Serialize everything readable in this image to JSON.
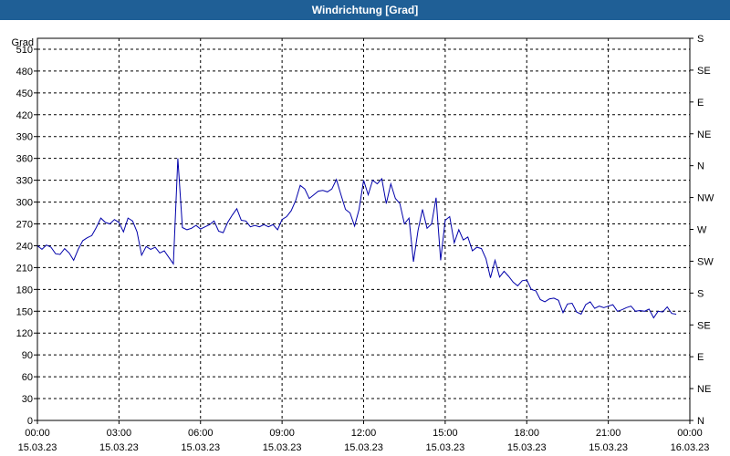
{
  "header": {
    "title": "Windrichtung [Grad]"
  },
  "chart_data": {
    "type": "line",
    "title": "Windrichtung [Grad]",
    "ylabel": "Grad",
    "xlabel": "",
    "ylim": [
      0,
      525
    ],
    "y_ticks": [
      0,
      30,
      60,
      90,
      120,
      150,
      180,
      210,
      240,
      270,
      300,
      330,
      360,
      390,
      420,
      450,
      480,
      510
    ],
    "y2_ticks": [
      {
        "value": 0,
        "label": "N"
      },
      {
        "value": 45,
        "label": "NE"
      },
      {
        "value": 90,
        "label": "E"
      },
      {
        "value": 135,
        "label": "SE"
      },
      {
        "value": 180,
        "label": "S"
      },
      {
        "value": 225,
        "label": "SW"
      },
      {
        "value": 270,
        "label": "W"
      },
      {
        "value": 315,
        "label": "NW"
      },
      {
        "value": 360,
        "label": "N"
      },
      {
        "value": 405,
        "label": "NE"
      },
      {
        "value": 450,
        "label": "E"
      },
      {
        "value": 495,
        "label": "SE"
      },
      {
        "value": 540,
        "label": "S"
      }
    ],
    "x_range": [
      "15.03.23 00:00",
      "16.03.23 00:00"
    ],
    "x_ticks": [
      {
        "time": "00:00",
        "date": "15.03.23"
      },
      {
        "time": "03:00",
        "date": "15.03.23"
      },
      {
        "time": "06:00",
        "date": "15.03.23"
      },
      {
        "time": "09:00",
        "date": "15.03.23"
      },
      {
        "time": "12:00",
        "date": "15.03.23"
      },
      {
        "time": "15:00",
        "date": "15.03.23"
      },
      {
        "time": "18:00",
        "date": "15.03.23"
      },
      {
        "time": "21:00",
        "date": "15.03.23"
      },
      {
        "time": "00:00",
        "date": "16.03.23"
      }
    ],
    "grid": true,
    "series": [
      {
        "color": "#0000aa",
        "points": [
          [
            "00:00",
            240
          ],
          [
            "00:10",
            235
          ],
          [
            "00:20",
            241
          ],
          [
            "00:30",
            238
          ],
          [
            "00:40",
            229
          ],
          [
            "00:50",
            228
          ],
          [
            "01:00",
            236
          ],
          [
            "01:10",
            230
          ],
          [
            "01:20",
            220
          ],
          [
            "01:30",
            235
          ],
          [
            "01:40",
            247
          ],
          [
            "01:50",
            251
          ],
          [
            "02:00",
            254
          ],
          [
            "02:10",
            265
          ],
          [
            "02:20",
            278
          ],
          [
            "02:30",
            272
          ],
          [
            "02:40",
            270
          ],
          [
            "02:50",
            276
          ],
          [
            "03:00",
            272
          ],
          [
            "03:10",
            259
          ],
          [
            "03:20",
            278
          ],
          [
            "03:30",
            274
          ],
          [
            "03:40",
            259
          ],
          [
            "03:50",
            227
          ],
          [
            "04:00",
            239
          ],
          [
            "04:10",
            235
          ],
          [
            "04:20",
            238
          ],
          [
            "04:30",
            230
          ],
          [
            "04:40",
            233
          ],
          [
            "04:50",
            224
          ],
          [
            "05:00",
            215
          ],
          [
            "05:10",
            360
          ],
          [
            "05:20",
            265
          ],
          [
            "05:30",
            262
          ],
          [
            "05:40",
            264
          ],
          [
            "05:50",
            268
          ],
          [
            "06:00",
            263
          ],
          [
            "06:10",
            266
          ],
          [
            "06:20",
            269
          ],
          [
            "06:30",
            274
          ],
          [
            "06:40",
            260
          ],
          [
            "06:50",
            258
          ],
          [
            "07:00",
            272
          ],
          [
            "07:10",
            282
          ],
          [
            "07:20",
            291
          ],
          [
            "07:30",
            275
          ],
          [
            "07:40",
            274
          ],
          [
            "07:50",
            266
          ],
          [
            "08:00",
            268
          ],
          [
            "08:10",
            266
          ],
          [
            "08:20",
            269
          ],
          [
            "08:30",
            266
          ],
          [
            "08:40",
            269
          ],
          [
            "08:50",
            262
          ],
          [
            "09:00",
            276
          ],
          [
            "09:10",
            280
          ],
          [
            "09:20",
            288
          ],
          [
            "09:30",
            302
          ],
          [
            "09:40",
            323
          ],
          [
            "09:50",
            318
          ],
          [
            "10:00",
            305
          ],
          [
            "10:10",
            310
          ],
          [
            "10:20",
            315
          ],
          [
            "10:30",
            316
          ],
          [
            "10:40",
            314
          ],
          [
            "10:50",
            318
          ],
          [
            "11:00",
            331
          ],
          [
            "11:10",
            310
          ],
          [
            "11:20",
            290
          ],
          [
            "11:30",
            285
          ],
          [
            "11:40",
            267
          ],
          [
            "11:50",
            290
          ],
          [
            "12:00",
            330
          ],
          [
            "12:10",
            310
          ],
          [
            "12:20",
            330
          ],
          [
            "12:30",
            325
          ],
          [
            "12:40",
            332
          ],
          [
            "12:50",
            298
          ],
          [
            "13:00",
            325
          ],
          [
            "13:10",
            305
          ],
          [
            "13:20",
            298
          ],
          [
            "13:30",
            270
          ],
          [
            "13:40",
            278
          ],
          [
            "13:50",
            218
          ],
          [
            "14:00",
            261
          ],
          [
            "14:10",
            290
          ],
          [
            "14:20",
            264
          ],
          [
            "14:30",
            270
          ],
          [
            "14:40",
            306
          ],
          [
            "14:50",
            220
          ],
          [
            "15:00",
            275
          ],
          [
            "15:10",
            280
          ],
          [
            "15:20",
            244
          ],
          [
            "15:30",
            262
          ],
          [
            "15:40",
            248
          ],
          [
            "15:50",
            252
          ],
          [
            "16:00",
            233
          ],
          [
            "16:10",
            238
          ],
          [
            "16:20",
            236
          ],
          [
            "16:30",
            222
          ],
          [
            "16:40",
            196
          ],
          [
            "16:50",
            220
          ],
          [
            "17:00",
            197
          ],
          [
            "17:10",
            205
          ],
          [
            "17:20",
            198
          ],
          [
            "17:30",
            190
          ],
          [
            "17:40",
            185
          ],
          [
            "17:50",
            192
          ],
          [
            "18:00",
            193
          ],
          [
            "18:10",
            180
          ],
          [
            "18:20",
            178
          ],
          [
            "18:30",
            166
          ],
          [
            "18:40",
            163
          ],
          [
            "18:50",
            167
          ],
          [
            "19:00",
            168
          ],
          [
            "19:10",
            165
          ],
          [
            "19:20",
            148
          ],
          [
            "19:30",
            160
          ],
          [
            "19:40",
            161
          ],
          [
            "19:50",
            149
          ],
          [
            "20:00",
            146
          ],
          [
            "20:10",
            159
          ],
          [
            "20:20",
            163
          ],
          [
            "20:30",
            154
          ],
          [
            "20:40",
            157
          ],
          [
            "20:50",
            155
          ],
          [
            "21:00",
            157
          ],
          [
            "21:10",
            159
          ],
          [
            "21:20",
            150
          ],
          [
            "21:30",
            152
          ],
          [
            "21:40",
            155
          ],
          [
            "21:50",
            157
          ],
          [
            "22:00",
            150
          ],
          [
            "22:10",
            151
          ],
          [
            "22:20",
            150
          ],
          [
            "22:30",
            153
          ],
          [
            "22:40",
            141
          ],
          [
            "22:50",
            150
          ],
          [
            "23:00",
            149
          ],
          [
            "23:10",
            156
          ],
          [
            "23:20",
            147
          ],
          [
            "23:30",
            146
          ]
        ]
      }
    ]
  }
}
